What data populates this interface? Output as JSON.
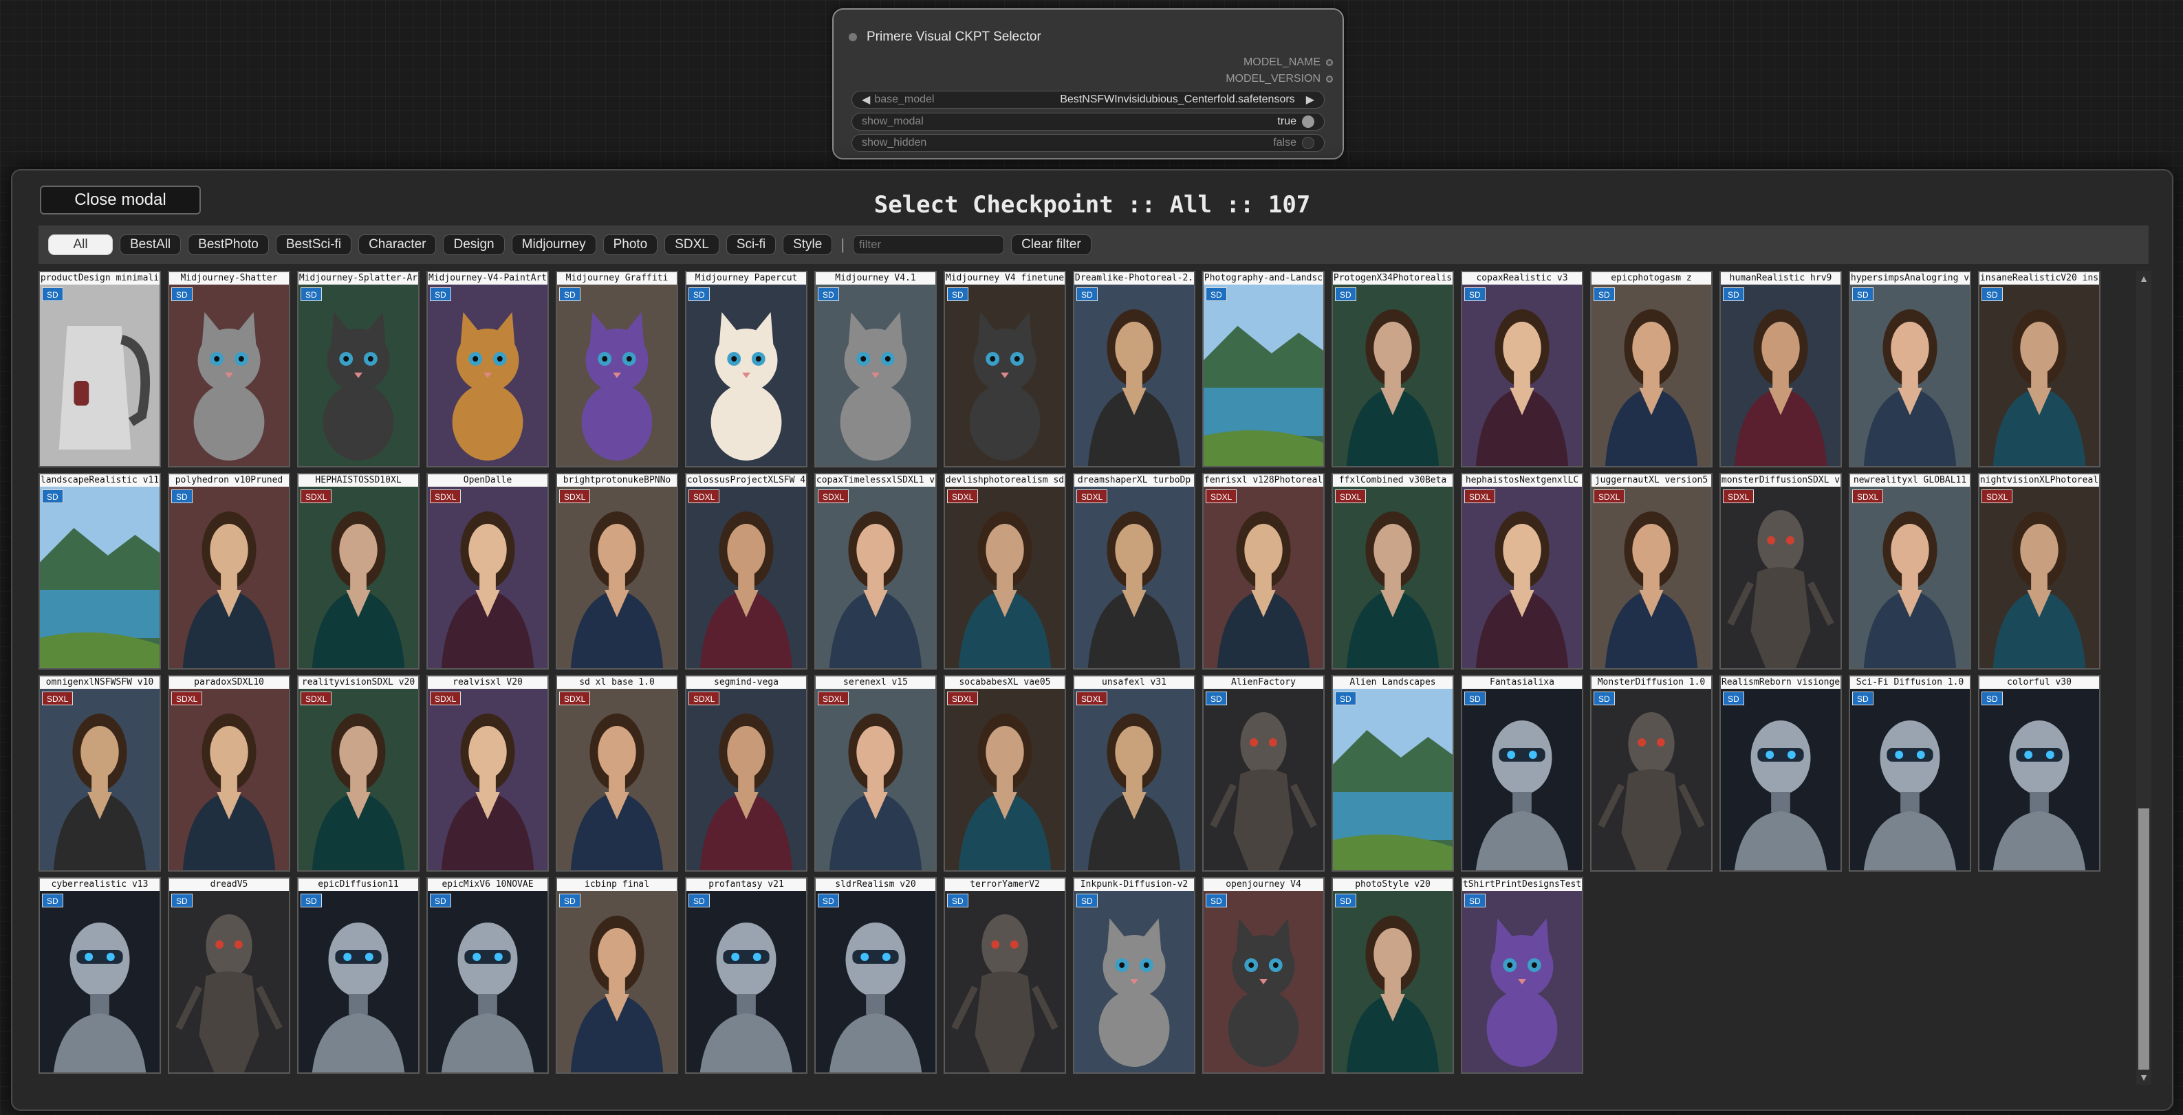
{
  "node": {
    "title": "Primere Visual CKPT Selector",
    "outputs": [
      "MODEL_NAME",
      "MODEL_VERSION"
    ],
    "widgets": [
      {
        "name": "base_model",
        "value": "BestNSFWInvisidubious_Centerfold.safetensors",
        "kind": "combo"
      },
      {
        "name": "show_modal",
        "value": "true",
        "kind": "toggle",
        "on": true
      },
      {
        "name": "show_hidden",
        "value": "false",
        "kind": "toggle",
        "on": false
      }
    ]
  },
  "modal": {
    "close_label": "Close modal",
    "title": "Select Checkpoint :: All :: 107",
    "filters": [
      "All",
      "BestAll",
      "BestPhoto",
      "BestSci-fi",
      "Character",
      "Design",
      "Midjourney",
      "Photo",
      "SDXL",
      "Sci-fi",
      "Style"
    ],
    "active_filter": "All",
    "separator": "|",
    "filter_placeholder": "filter",
    "clear_label": "Clear filter"
  },
  "colors": {
    "sd_badge": "#1e6fbf",
    "sdxl_badge": "#8d2222"
  },
  "checkpoints": [
    {
      "name": "productDesign minimali",
      "badge": "SD",
      "icon": "kettle-icon"
    },
    {
      "name": "Midjourney-Shatter",
      "badge": "SD",
      "icon": "cat-icon"
    },
    {
      "name": "Midjourney-Splatter-Ar",
      "badge": "SD",
      "icon": "cat-icon"
    },
    {
      "name": "Midjourney-V4-PaintArt",
      "badge": "SD",
      "icon": "cat-icon"
    },
    {
      "name": "Midjourney Graffiti",
      "badge": "SD",
      "icon": "cat-icon"
    },
    {
      "name": "Midjourney Papercut",
      "badge": "SD",
      "icon": "cat-icon"
    },
    {
      "name": "Midjourney V4.1",
      "badge": "SD",
      "icon": "cat-icon"
    },
    {
      "name": "Midjourney V4 finetune",
      "badge": "SD",
      "icon": "cat-icon"
    },
    {
      "name": "Dreamlike-Photoreal-2.",
      "badge": "SD",
      "icon": "portrait-icon"
    },
    {
      "name": "Photography-and-Landsc",
      "badge": "SD",
      "icon": "landscape-icon"
    },
    {
      "name": "ProtogenX34Photorealis",
      "badge": "SD",
      "icon": "portrait-icon"
    },
    {
      "name": "copaxRealistic v3",
      "badge": "SD",
      "icon": "portrait-icon"
    },
    {
      "name": "epicphotogasm z",
      "badge": "SD",
      "icon": "portrait-icon"
    },
    {
      "name": "humanRealistic hrv9",
      "badge": "SD",
      "icon": "portrait-icon"
    },
    {
      "name": "hypersimpsAnalogring v",
      "badge": "SD",
      "icon": "portrait-icon"
    },
    {
      "name": "insaneRealisticV20 ins",
      "badge": "SD",
      "icon": "portrait-icon"
    },
    {
      "name": "landscapeRealistic v11",
      "badge": "SD",
      "icon": "landscape-icon"
    },
    {
      "name": "polyhedron v10Pruned",
      "badge": "SD",
      "icon": "portrait-icon"
    },
    {
      "name": "HEPHAISTOSSD10XL",
      "badge": "SDXL",
      "icon": "portrait-icon"
    },
    {
      "name": "OpenDalle",
      "badge": "SDXL",
      "icon": "portrait-icon"
    },
    {
      "name": "brightprotonukeBPNNo",
      "badge": "SDXL",
      "icon": "portrait-icon"
    },
    {
      "name": "colossusProjectXLSFW 4",
      "badge": "SDXL",
      "icon": "portrait-icon"
    },
    {
      "name": "copaxTimelessxlSDXL1 v",
      "badge": "SDXL",
      "icon": "portrait-icon"
    },
    {
      "name": "devlishphotorealism sd",
      "badge": "SDXL",
      "icon": "portrait-icon"
    },
    {
      "name": "dreamshaperXL turboDp",
      "badge": "SDXL",
      "icon": "portrait-icon"
    },
    {
      "name": "fenrisxl v128Photoreal",
      "badge": "SDXL",
      "icon": "portrait-icon"
    },
    {
      "name": "ffxlCombined v30Beta",
      "badge": "SDXL",
      "icon": "portrait-icon"
    },
    {
      "name": "hephaistosNextgenxlLC",
      "badge": "SDXL",
      "icon": "portrait-icon"
    },
    {
      "name": "juggernautXL version5",
      "badge": "SDXL",
      "icon": "portrait-icon"
    },
    {
      "name": "monsterDiffusionSDXL v",
      "badge": "SDXL",
      "icon": "monster-icon"
    },
    {
      "name": "newrealityxl GLOBAL11",
      "badge": "SDXL",
      "icon": "portrait-icon"
    },
    {
      "name": "nightvisionXLPhotoreal",
      "badge": "SDXL",
      "icon": "portrait-icon"
    },
    {
      "name": "omnigenxlNSFWSFW v10",
      "badge": "SDXL",
      "icon": "portrait-icon"
    },
    {
      "name": "paradoxSDXL10",
      "badge": "SDXL",
      "icon": "portrait-icon"
    },
    {
      "name": "realityvisionSDXL v20",
      "badge": "SDXL",
      "icon": "portrait-icon"
    },
    {
      "name": "realvisxl V20",
      "badge": "SDXL",
      "icon": "portrait-icon"
    },
    {
      "name": "sd xl base 1.0",
      "badge": "SDXL",
      "icon": "portrait-icon"
    },
    {
      "name": "segmind-vega",
      "badge": "SDXL",
      "icon": "portrait-icon"
    },
    {
      "name": "serenexl v15",
      "badge": "SDXL",
      "icon": "portrait-icon"
    },
    {
      "name": "socababesXL vae05",
      "badge": "SDXL",
      "icon": "portrait-icon"
    },
    {
      "name": "unsafexl v31",
      "badge": "SDXL",
      "icon": "portrait-icon"
    },
    {
      "name": "AlienFactory",
      "badge": "SD",
      "icon": "alien-icon"
    },
    {
      "name": "Alien Landscapes",
      "badge": "SD",
      "icon": "landscape-icon"
    },
    {
      "name": "Fantasialixa",
      "badge": "SD",
      "icon": "robot-icon"
    },
    {
      "name": "MonsterDiffusion 1.0",
      "badge": "SD",
      "icon": "monster-icon"
    },
    {
      "name": "RealismReborn visionge",
      "badge": "SD",
      "icon": "robot-icon"
    },
    {
      "name": "Sci-Fi Diffusion 1.0",
      "badge": "SD",
      "icon": "robot-icon"
    },
    {
      "name": "colorful v30",
      "badge": "SD",
      "icon": "robot-icon"
    },
    {
      "name": "cyberrealistic v13",
      "badge": "SD",
      "icon": "robot-icon"
    },
    {
      "name": "dreadV5",
      "badge": "SD",
      "icon": "monster-icon"
    },
    {
      "name": "epicDiffusion11",
      "badge": "SD",
      "icon": "robot-icon"
    },
    {
      "name": "epicMixV6 10NOVAE",
      "badge": "SD",
      "icon": "robot-icon"
    },
    {
      "name": "icbinp final",
      "badge": "SD",
      "icon": "portrait-icon"
    },
    {
      "name": "profantasy v21",
      "badge": "SD",
      "icon": "robot-icon"
    },
    {
      "name": "sldrRealism v20",
      "badge": "SD",
      "icon": "robot-icon"
    },
    {
      "name": "terrorYamerV2",
      "badge": "SD",
      "icon": "monster-icon"
    },
    {
      "name": "Inkpunk-Diffusion-v2",
      "badge": "SD",
      "icon": "cat-icon"
    },
    {
      "name": "openjourney V4",
      "badge": "SD",
      "icon": "cat-icon"
    },
    {
      "name": "photoStyle v20",
      "badge": "SD",
      "icon": "portrait-icon"
    },
    {
      "name": "tShirtPrintDesignsTest",
      "badge": "SD",
      "icon": "cat-icon"
    }
  ],
  "scrollbar": {
    "up": "▲",
    "down": "▼"
  }
}
